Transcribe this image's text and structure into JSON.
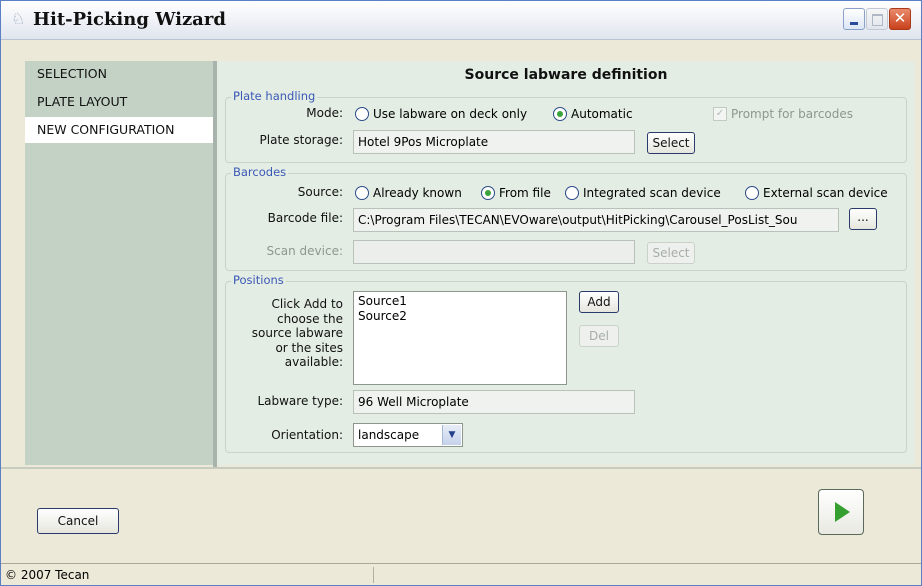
{
  "window": {
    "title": "Hit-Picking Wizard"
  },
  "sidebar": {
    "items": [
      {
        "label": "SELECTION",
        "active": false
      },
      {
        "label": "PLATE LAYOUT",
        "active": false
      },
      {
        "label": "NEW CONFIGURATION",
        "active": true
      }
    ]
  },
  "page": {
    "heading": "Source labware definition"
  },
  "plate_handling": {
    "legend": "Plate handling",
    "mode_label": "Mode:",
    "mode_options": [
      {
        "label": "Use labware on deck only",
        "checked": false
      },
      {
        "label": "Automatic",
        "checked": true
      }
    ],
    "prompt_barcodes": "Prompt for barcodes",
    "plate_storage_label": "Plate storage:",
    "plate_storage_value": "Hotel 9Pos Microplate",
    "select_button": "Select"
  },
  "barcodes": {
    "legend": "Barcodes",
    "source_label": "Source:",
    "source_options": [
      {
        "label": "Already known",
        "checked": false
      },
      {
        "label": "From file",
        "checked": true
      },
      {
        "label": "Integrated scan device",
        "checked": false
      },
      {
        "label": "External scan device",
        "checked": false
      }
    ],
    "file_label": "Barcode file:",
    "file_value": "C:\\Program Files\\TECAN\\EVOware\\output\\HitPicking\\Carousel_PosList_Sou",
    "browse_button": "...",
    "scan_device_label": "Scan device:",
    "scan_select_button": "Select"
  },
  "positions": {
    "legend": "Positions",
    "instructions_lines": [
      "Click Add to",
      "choose the",
      "source labware",
      "or the sites",
      "available:"
    ],
    "list_items": [
      "Source1",
      "Source2"
    ],
    "add_button": "Add",
    "del_button": "Del",
    "labware_type_label": "Labware type:",
    "labware_type_value": "96 Well Microplate",
    "orientation_label": "Orientation:",
    "orientation_value": "landscape"
  },
  "footer": {
    "cancel_button": "Cancel",
    "next_icon": "play-icon"
  },
  "statusbar": {
    "text": "© 2007 Tecan"
  }
}
